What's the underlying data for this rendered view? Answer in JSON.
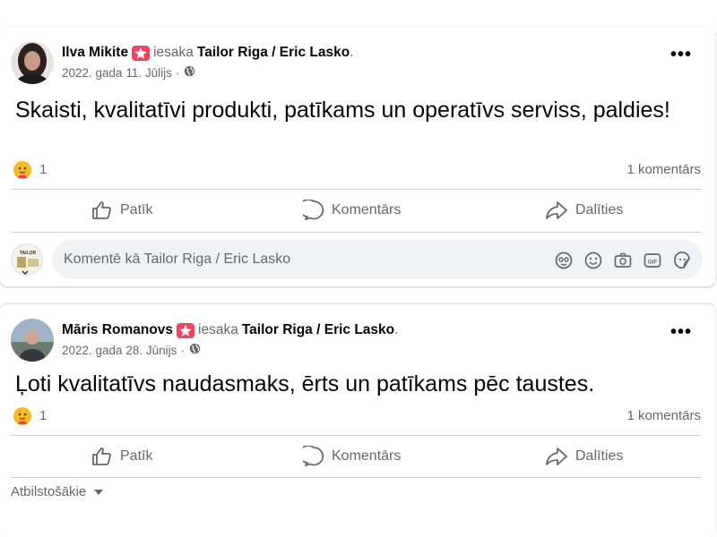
{
  "colors": {
    "text": "#050505",
    "secondary": "#65676b",
    "badge": "#f3425f",
    "divider": "#ced0d4",
    "input_bg": "#f0f2f5"
  },
  "posts": [
    {
      "author": "Ilva Mikite",
      "recommends": "iesaka",
      "page": "Tailor Riga / Eric Lasko",
      "date": "2022. gada 11. Jūlijs",
      "sep": "·",
      "text": "Skaisti, kvalitatīvi produkti, patīkams un operatīvs serviss, paldies!",
      "reaction_count": "1",
      "comments": "1 komentārs",
      "actions": {
        "like": "Patīk",
        "comment": "Komentārs",
        "share": "Dalīties"
      },
      "comment_placeholder": "Komentē kā Tailor Riga / Eric Lasko"
    },
    {
      "author": "Māris Romanovs",
      "recommends": "iesaka",
      "page": "Tailor Riga / Eric Lasko",
      "date": "2022. gada 28. Jūnijs",
      "sep": "·",
      "text": "Ļoti kvalitatīvs naudasmaks, ērts un patīkams pēc taustes.",
      "reaction_count": "1",
      "comments": "1 komentārs",
      "actions": {
        "like": "Patīk",
        "comment": "Komentārs",
        "share": "Dalīties"
      },
      "sort_label": "Atbilstošākie"
    }
  ],
  "icons": [
    "star-badge-icon",
    "globe-icon",
    "more-icon",
    "care-reaction-icon",
    "like-icon",
    "comment-icon",
    "share-icon",
    "avatar-emoji-icon",
    "sticker-icon",
    "camera-icon",
    "gif-icon",
    "emoji-icon",
    "chevron-down-icon"
  ]
}
